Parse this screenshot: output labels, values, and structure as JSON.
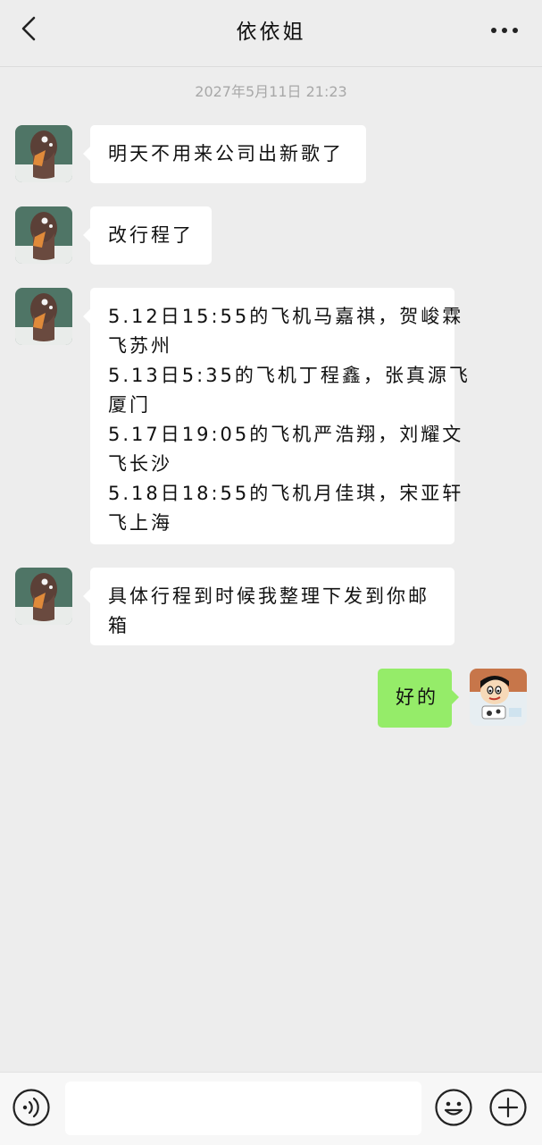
{
  "header": {
    "title": "依依姐"
  },
  "timestamp": "2027年5月11日 21:23",
  "messages": [
    {
      "sender": "contact",
      "lines": [
        "明天不用来公司出新歌了"
      ]
    },
    {
      "sender": "contact",
      "lines": [
        "改行程了"
      ]
    },
    {
      "sender": "contact",
      "lines": [
        "5.12日15:55的飞机马嘉祺，贺峻霖",
        "飞苏州",
        "5.13日5:35的飞机丁程鑫，张真源飞",
        "厦门",
        "5.17日19:05的飞机严浩翔，刘耀文",
        "飞长沙",
        "5.18日18:55的飞机月佳琪，宋亚轩",
        "飞上海"
      ]
    },
    {
      "sender": "contact",
      "lines": [
        "具体行程到时候我整理下发到你邮",
        "箱"
      ]
    },
    {
      "sender": "me",
      "lines": [
        "好的"
      ]
    }
  ],
  "input": {
    "value": "",
    "placeholder": ""
  },
  "icons": {
    "back": "chevron-left-icon",
    "more": "more-dots-icon",
    "voice": "voice-icon",
    "emoji": "emoji-icon",
    "plus": "plus-icon"
  },
  "colors": {
    "background": "#ededed",
    "bubble_contact": "#ffffff",
    "bubble_me": "#95ec69",
    "bottom_bar": "#f7f7f7"
  }
}
